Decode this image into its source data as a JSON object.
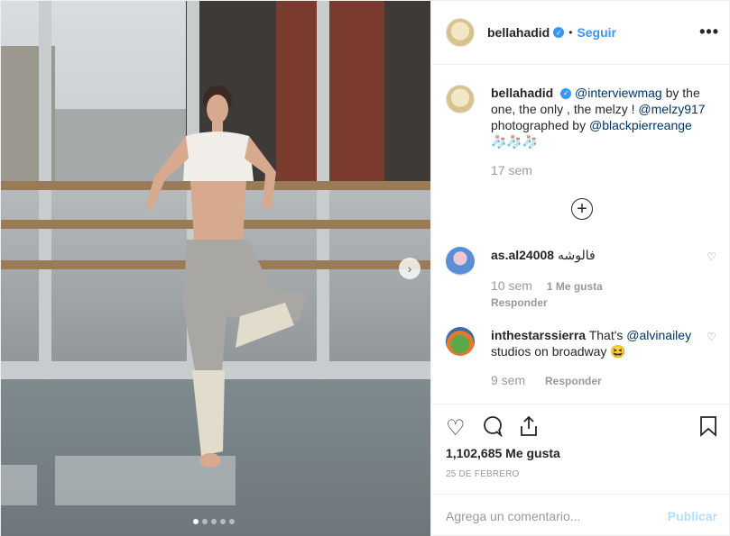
{
  "header": {
    "username": "bellahadid",
    "follow_label": "Seguir",
    "separator": "•",
    "more_label": "•••"
  },
  "caption": {
    "username": "bellahadid",
    "mention1": "@interviewmag",
    "text1": " by the one, the only , the melzy ! ",
    "mention2": "@melzy917",
    "text2": " photographed by ",
    "mention3": "@blackpierreange",
    "emoji": "🧦🧦🧦",
    "time": "17 sem"
  },
  "comments": [
    {
      "username": "as.al24008",
      "text": "فالوشه",
      "time": "10 sem",
      "likes": "1 Me gusta",
      "reply": "Responder"
    },
    {
      "username": "inthestarssierra",
      "text1": "That's ",
      "mention": "@alvinailey",
      "text2": " studios on broadway ",
      "emoji": "😆",
      "time": "9 sem",
      "reply": "Responder"
    }
  ],
  "load_more": "+",
  "likes_count": "1,102,685 Me gusta",
  "date": "25 DE FEBRERO",
  "add_comment": {
    "placeholder": "Agrega un comentario...",
    "publish": "Publicar"
  },
  "carousel": {
    "total": 5,
    "active": 0,
    "next_icon": "›"
  },
  "colors": {
    "accent": "#3897f0",
    "link": "#003569",
    "muted": "#999999",
    "publish_disabled": "#b2dffc"
  }
}
